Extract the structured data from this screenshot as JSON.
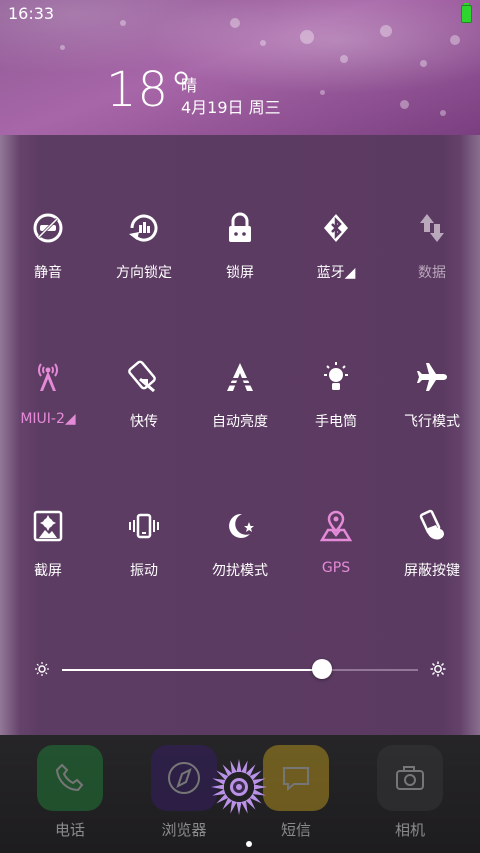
{
  "status": {
    "time": "16:33"
  },
  "weather": {
    "temperature": "18°",
    "condition": "晴",
    "date": "4月19日 周三"
  },
  "toggles": [
    {
      "label": "静音"
    },
    {
      "label": "方向锁定"
    },
    {
      "label": "锁屏"
    },
    {
      "label": "蓝牙◢"
    },
    {
      "label": "数据"
    },
    {
      "label": "MIUI-2◢"
    },
    {
      "label": "快传"
    },
    {
      "label": "自动亮度"
    },
    {
      "label": "手电筒"
    },
    {
      "label": "飞行模式"
    },
    {
      "label": "截屏"
    },
    {
      "label": "振动"
    },
    {
      "label": "勿扰模式"
    },
    {
      "label": "GPS"
    },
    {
      "label": "屏蔽按键"
    }
  ],
  "brightness": {
    "level": 0.73
  },
  "dock": [
    {
      "label": "电话"
    },
    {
      "label": "浏览器"
    },
    {
      "label": "短信"
    },
    {
      "label": "相机"
    }
  ],
  "colors": {
    "accent_pink": "#e58ad8",
    "panel": "#5b3a61",
    "battery": "#2fd52f"
  }
}
